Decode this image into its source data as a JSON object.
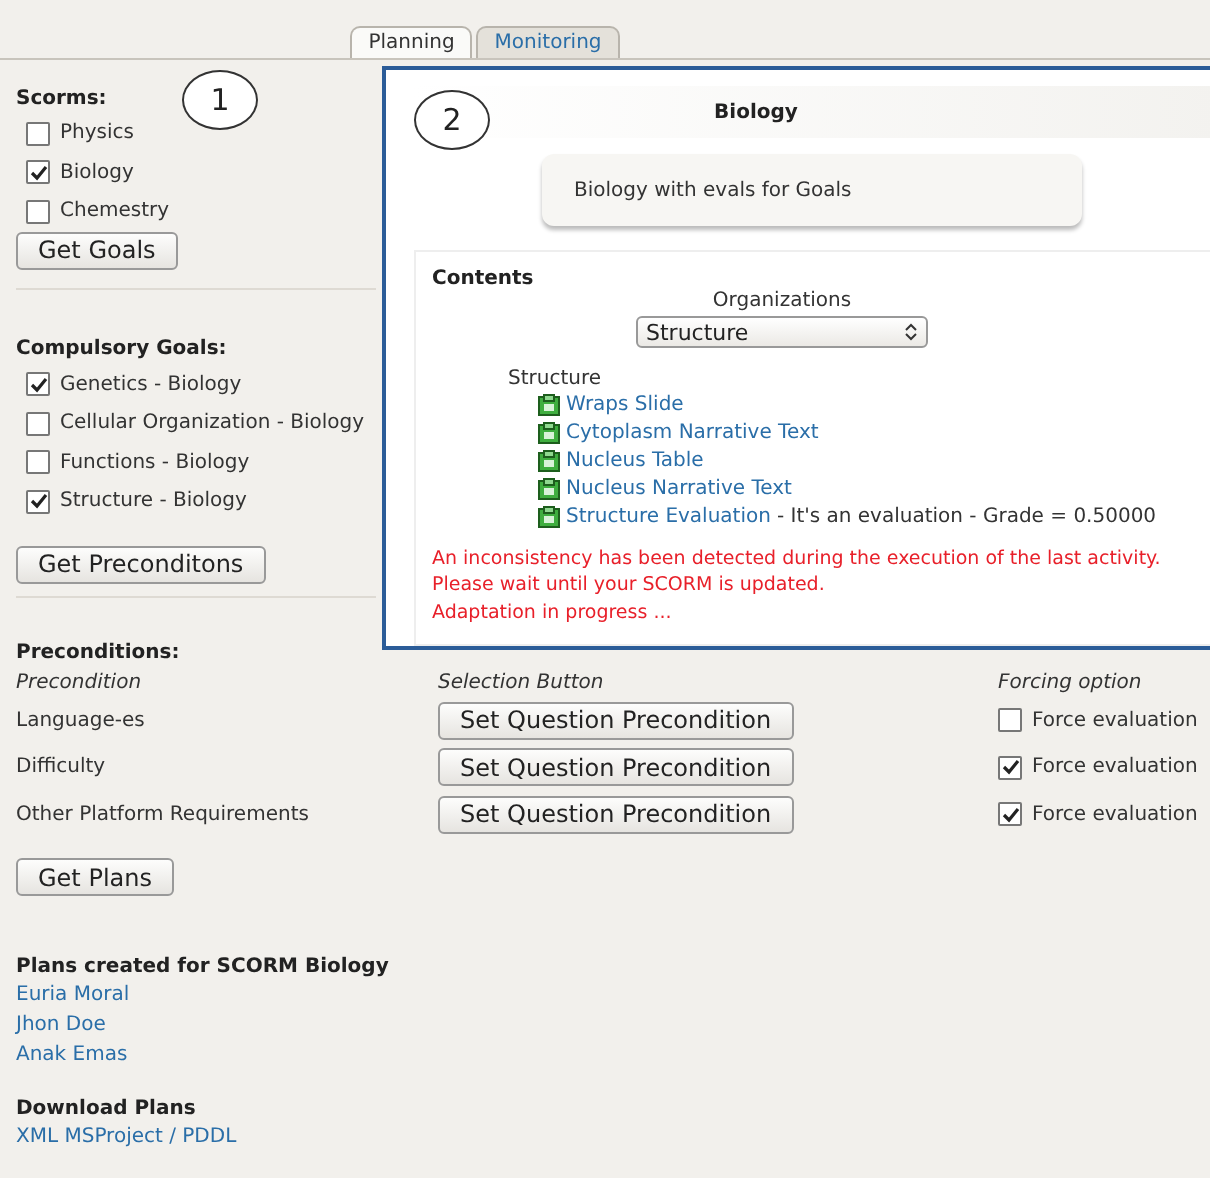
{
  "tabs": [
    {
      "label": "Planning",
      "selected": true
    },
    {
      "label": "Monitoring",
      "selected": false
    }
  ],
  "callouts": [
    "1",
    "2"
  ],
  "scorms": {
    "title": "Scorms:",
    "items": [
      {
        "label": "Physics",
        "checked": false
      },
      {
        "label": "Biology",
        "checked": true
      },
      {
        "label": "Chemestry",
        "checked": false
      }
    ],
    "button": "Get Goals"
  },
  "goals": {
    "title": "Compulsory Goals:",
    "items": [
      {
        "label": "Genetics - Biology",
        "checked": true
      },
      {
        "label": "Cellular Organization - Biology",
        "checked": false
      },
      {
        "label": "Functions - Biology",
        "checked": false
      },
      {
        "label": "Structure - Biology",
        "checked": true
      }
    ],
    "button": "Get Preconditons"
  },
  "preconditions": {
    "title": "Preconditions:",
    "columns": [
      "Precondition",
      "Selection Button",
      "Forcing option"
    ],
    "rows": [
      {
        "name": "Language-es",
        "button": "Set Question Precondition",
        "option": "Force evaluation",
        "checked": false
      },
      {
        "name": "Difficulty",
        "button": "Set Question Precondition",
        "option": "Force evaluation",
        "checked": true
      },
      {
        "name": "Other Platform Requirements",
        "button": "Set Question Precondition",
        "option": "Force evaluation",
        "checked": true
      }
    ],
    "button": "Get Plans"
  },
  "plans": {
    "title": "Plans created for SCORM Biology",
    "links": [
      "Euria Moral",
      "Jhon Doe",
      "Anak Emas"
    ]
  },
  "download": {
    "title": "Download Plans",
    "link": "XML MSProject / PDDL"
  },
  "panel": {
    "title": "Biology",
    "description": "Biology with evals for Goals",
    "contents_title": "Contents",
    "organizations_label": "Organizations",
    "select_value": "Structure",
    "tree": {
      "label": "Structure",
      "children": [
        {
          "label": "Wraps Slide"
        },
        {
          "label": "Cytoplasm Narrative Text"
        },
        {
          "label": "Nucleus Table"
        },
        {
          "label": "Nucleus Narrative Text"
        },
        {
          "label": "Structure Evaluation",
          "note": " - It's an evaluation - Grade = 0.50000"
        }
      ]
    },
    "messages": [
      "An inconsistency has been detected during the execution of the last activity.",
      "Please wait until your SCORM is updated.",
      "Adaptation in progress ..."
    ]
  }
}
